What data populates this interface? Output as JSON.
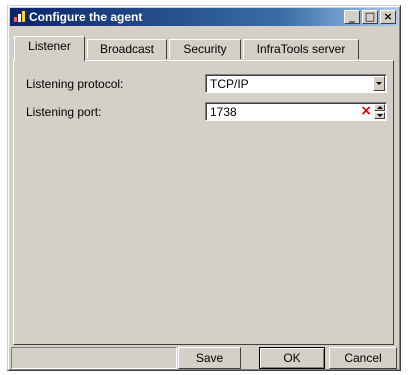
{
  "window": {
    "title": "Configure the agent"
  },
  "titlebar_buttons": {
    "minimize": "_",
    "maximize": "□",
    "close": "×"
  },
  "tabs": [
    {
      "label": "Listener",
      "active": true
    },
    {
      "label": "Broadcast",
      "active": false
    },
    {
      "label": "Security",
      "active": false
    },
    {
      "label": "InfraTools server",
      "active": false
    }
  ],
  "listener": {
    "protocol_label": "Listening protocol:",
    "protocol_value": "TCP/IP",
    "port_label": "Listening port:",
    "port_value": "1738",
    "clear_symbol": "×"
  },
  "buttons": {
    "save": "Save",
    "ok": "OK",
    "cancel": "Cancel"
  },
  "colors": {
    "title_start": "#0a246a",
    "title_end": "#a6caf0",
    "clear_x": "#e00000"
  }
}
